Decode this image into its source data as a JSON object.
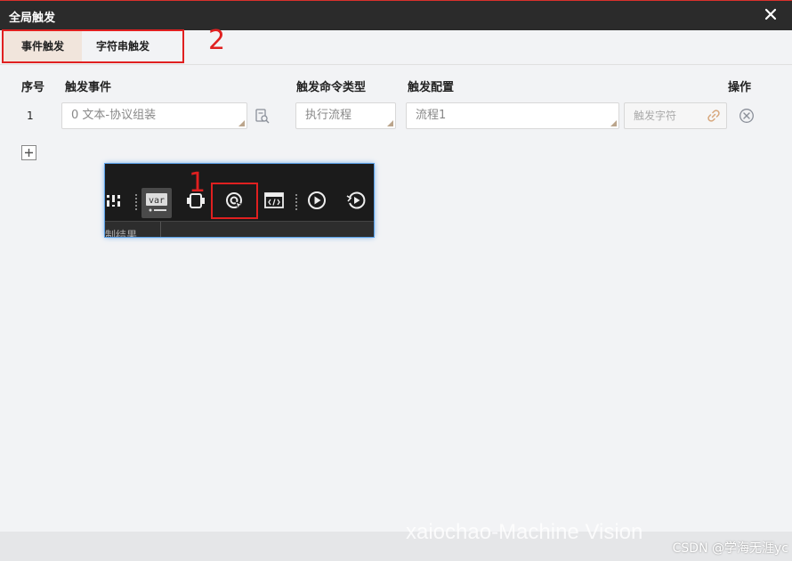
{
  "window": {
    "title": "全局触发"
  },
  "tabs": [
    {
      "label": "事件触发",
      "active": true
    },
    {
      "label": "字符串触发",
      "active": false
    }
  ],
  "annotations": {
    "label_1": "1",
    "label_2": "2"
  },
  "table": {
    "headers": {
      "index": "序号",
      "event": "触发事件",
      "cmd_type": "触发命令类型",
      "config": "触发配置",
      "action": "操作"
    },
    "rows": [
      {
        "index": "1",
        "event": "0 文本-协议组装",
        "cmd_type": "执行流程",
        "config": "流程1",
        "trigger_string_placeholder": "触发字符"
      }
    ]
  },
  "inset": {
    "partial_text": "制结果"
  },
  "watermark": {
    "text": "xaiochao-Machine Vision",
    "csdn": "CSDN @学海无涯yc"
  },
  "colors": {
    "accent_red": "#e02020",
    "titlebar": "#2b2b2b",
    "active_tab": "#f1e5dc"
  }
}
